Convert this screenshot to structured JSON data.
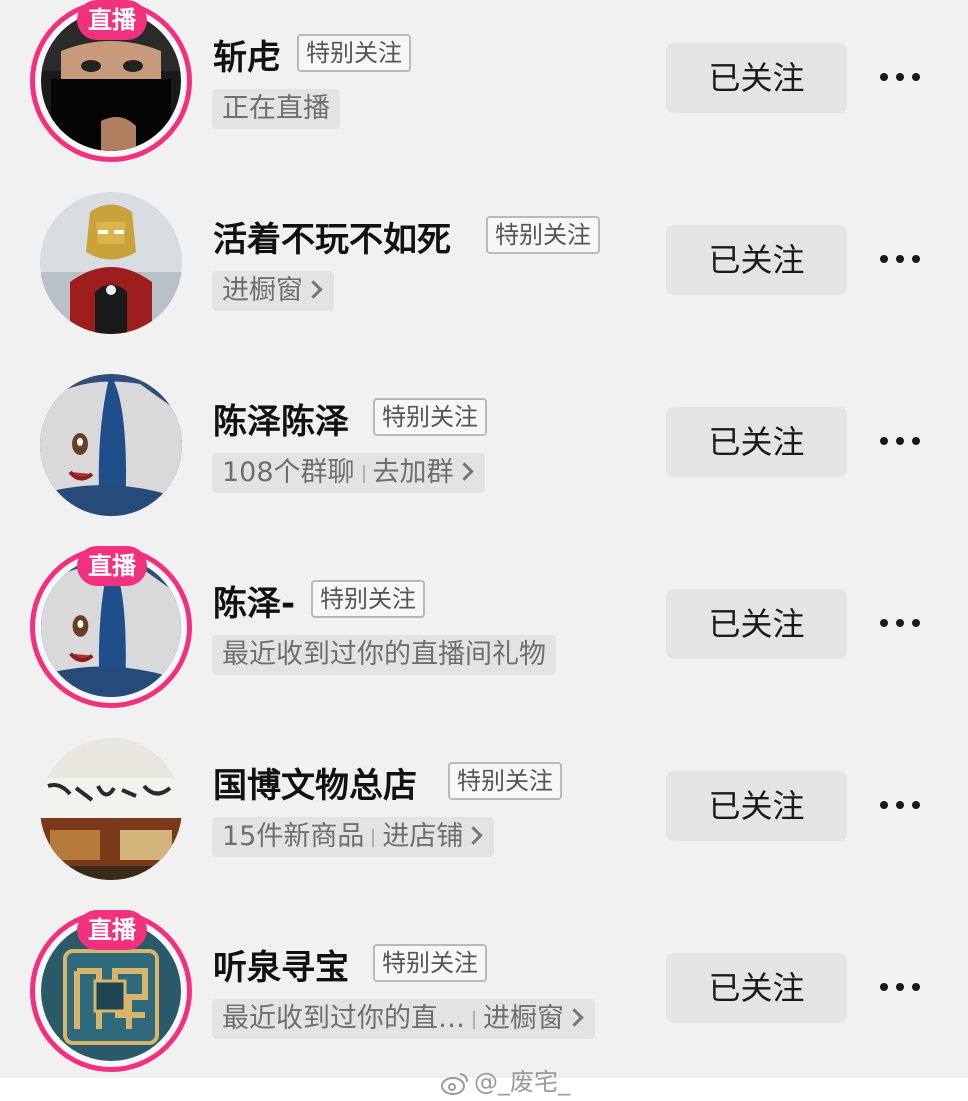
{
  "following_list": [
    {
      "name": "斩虍",
      "tag": "特别关注",
      "live": true,
      "live_label": "直播",
      "sub_primary": "正在直播",
      "sub_secondary": "",
      "follow_label": "已关注",
      "avatar_icon": "masked-figure-avatar"
    },
    {
      "name": "活着不玩不如死",
      "tag": "特别关注",
      "live": false,
      "live_label": "",
      "sub_primary": "进橱窗",
      "sub_secondary": "",
      "follow_label": "已关注",
      "avatar_icon": "ironman-avatar"
    },
    {
      "name": "陈泽陈泽",
      "tag": "特别关注",
      "live": false,
      "live_label": "",
      "sub_primary": "108个群聊",
      "sub_secondary": "去加群",
      "follow_label": "已关注",
      "avatar_icon": "anime-girl-avatar"
    },
    {
      "name": "陈泽-",
      "tag": "特别关注",
      "live": true,
      "live_label": "直播",
      "sub_primary": "最近收到过你的直播间礼物",
      "sub_secondary": "",
      "follow_label": "已关注",
      "avatar_icon": "anime-girl-avatar"
    },
    {
      "name": "国博文物总店",
      "tag": "特别关注",
      "live": false,
      "live_label": "",
      "sub_primary": "15件新商品",
      "sub_secondary": "进店铺",
      "follow_label": "已关注",
      "avatar_icon": "storefront-avatar"
    },
    {
      "name": "听泉寻宝",
      "tag": "特别关注",
      "live": true,
      "live_label": "直播",
      "sub_primary": "最近收到过你的直…",
      "sub_secondary": "进橱窗",
      "follow_label": "已关注",
      "avatar_icon": "tingquan-logo-avatar"
    }
  ],
  "watermark": "@_废宅_",
  "colors": {
    "live_pink": "#f2317e",
    "background": "#f1f1f1",
    "button_bg": "#e4e4e4"
  }
}
